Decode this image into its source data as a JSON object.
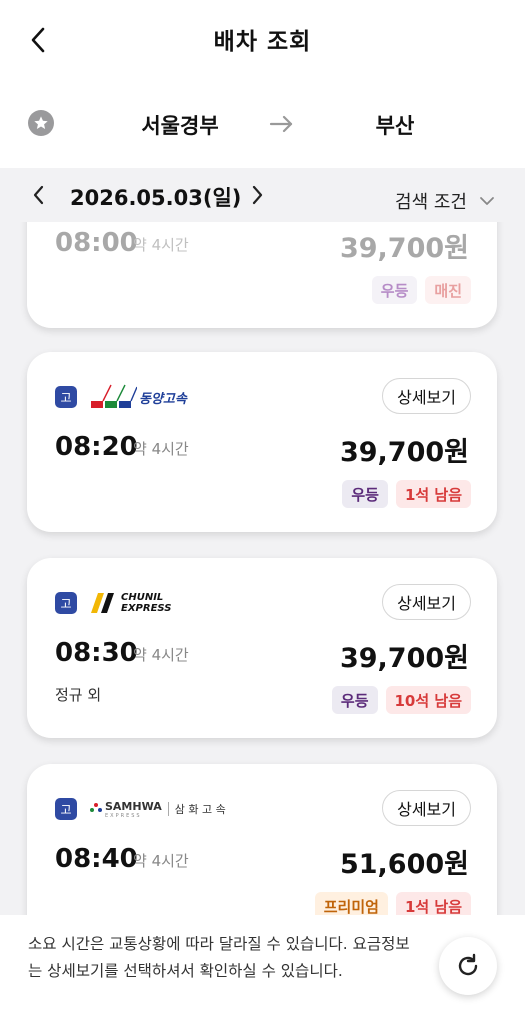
{
  "header": {
    "title": "배차 조회"
  },
  "route": {
    "from": "서울경부",
    "to": "부산"
  },
  "date_bar": {
    "date": "2026.05.03(일)",
    "search_condition": "검색 조건"
  },
  "cards": [
    {
      "time": "08:00",
      "duration": "약 4시간",
      "price": "39,700원",
      "grade": "우등",
      "seats": "매진",
      "detail": "",
      "note": "",
      "company": ""
    },
    {
      "time": "08:20",
      "duration": "약 4시간",
      "price": "39,700원",
      "grade": "우등",
      "seats": "1석 남음",
      "detail": "상세보기",
      "type": "고",
      "company": "동양고속",
      "note": ""
    },
    {
      "time": "08:30",
      "duration": "약 4시간",
      "price": "39,700원",
      "grade": "우등",
      "seats": "10석 남음",
      "detail": "상세보기",
      "type": "고",
      "company": "CHUNIL EXPRESS",
      "note": "정규 외"
    },
    {
      "time": "08:40",
      "duration": "약 4시간",
      "price": "51,600원",
      "grade": "프리미엄",
      "seats": "1석 남음",
      "detail": "상세보기",
      "type": "고",
      "company": "SAMHWA",
      "company_kr": "삼 화 고 속",
      "company_sub": "EXPRESS",
      "note": ""
    }
  ],
  "footer": {
    "note": "소요 시간은 교통상황에 따라 달라질 수 있습니다. 요금정보는 상세보기를 선택하셔서 확인하실 수 있습니다."
  },
  "colors": {
    "type_badge": "#2f4aa3",
    "grade_text": "#5b2b7a",
    "seats_text": "#d73a3a",
    "premium_text": "#c0640a"
  }
}
